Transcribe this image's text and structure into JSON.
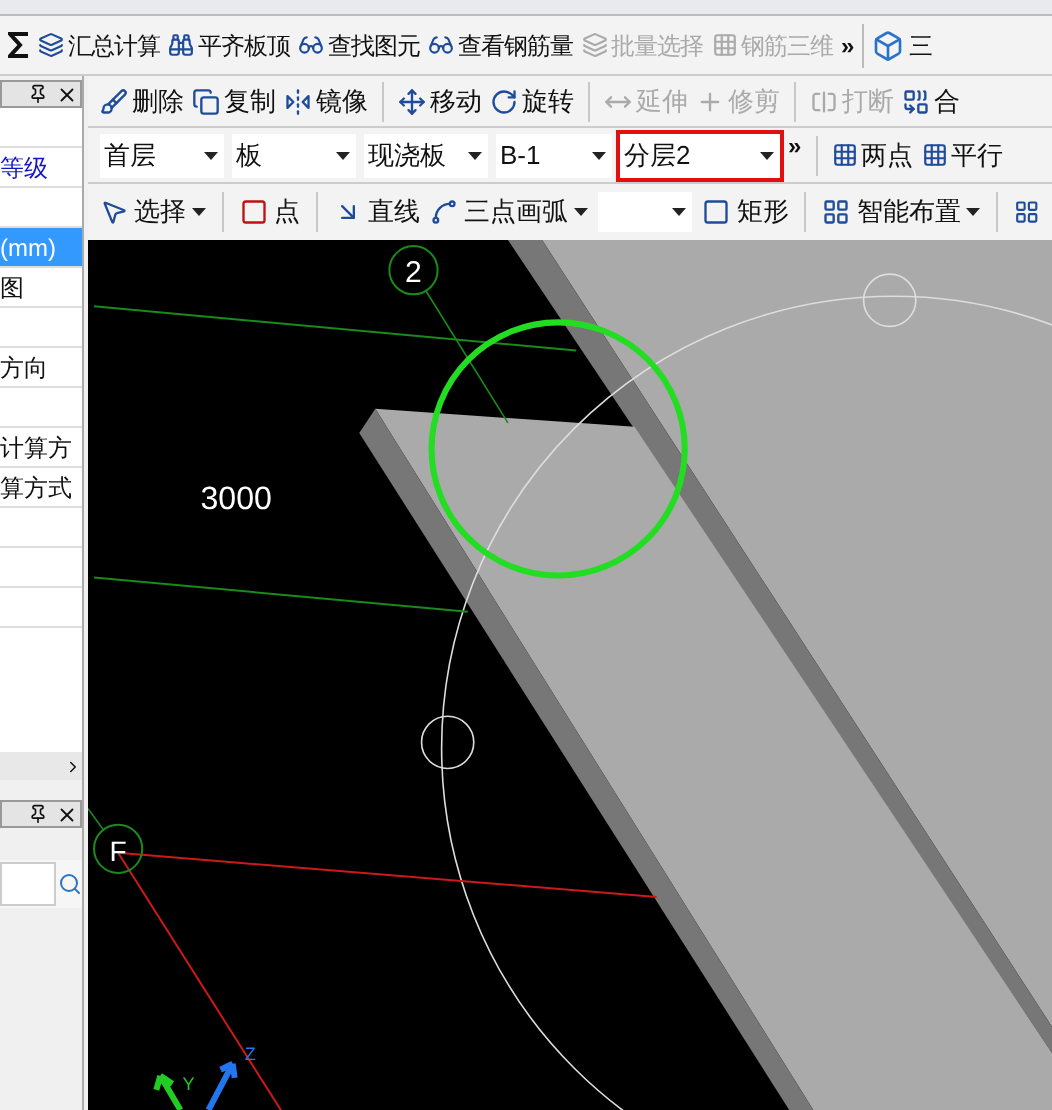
{
  "main_toolbar": {
    "items": [
      {
        "label": "汇总计算",
        "disabled": false
      },
      {
        "label": "平齐板顶",
        "disabled": false
      },
      {
        "label": "查找图元",
        "disabled": false
      },
      {
        "label": "查看钢筋量",
        "disabled": false
      },
      {
        "label": "批量选择",
        "disabled": true
      },
      {
        "label": "钢筋三维",
        "disabled": true
      }
    ],
    "overflow": "»",
    "view_tab": "三"
  },
  "edit_toolbar": {
    "items": [
      {
        "label": "删除",
        "disabled": false
      },
      {
        "label": "复制",
        "disabled": false
      },
      {
        "label": "镜像",
        "disabled": false
      },
      {
        "label": "移动",
        "disabled": false
      },
      {
        "label": "旋转",
        "disabled": false
      },
      {
        "label": "延伸",
        "disabled": true
      },
      {
        "label": "修剪",
        "disabled": true
      },
      {
        "label": "打断",
        "disabled": true
      },
      {
        "label": "合",
        "disabled": false
      }
    ]
  },
  "selector_toolbar": {
    "combos": [
      {
        "value": "首层",
        "highlighted": false
      },
      {
        "value": "板",
        "highlighted": false
      },
      {
        "value": "现浇板",
        "highlighted": false
      },
      {
        "value": "B-1",
        "highlighted": false
      },
      {
        "value": "分层2",
        "highlighted": true
      }
    ],
    "overflow": "»",
    "tools": [
      "两点",
      "平行"
    ]
  },
  "draw_toolbar": {
    "items": [
      {
        "kind": "dropdown",
        "label": "选择"
      },
      {
        "kind": "button",
        "label": "点"
      },
      {
        "kind": "button",
        "label": "直线"
      },
      {
        "kind": "dropdown",
        "label": "三点画弧"
      },
      {
        "kind": "combo"
      },
      {
        "kind": "button",
        "label": "矩形"
      },
      {
        "kind": "dropdown",
        "label": "智能布置"
      }
    ]
  },
  "property_panel": {
    "rows": [
      {
        "selected": false
      },
      {
        "label": "等级",
        "selected": false,
        "link": true
      },
      {
        "selected": false
      },
      {
        "label": "(mm)",
        "selected": true,
        "link": false
      },
      {
        "label": "图",
        "selected": false,
        "link": false
      },
      {
        "selected": false
      },
      {
        "label": "方向",
        "selected": false,
        "link": false
      },
      {
        "selected": false
      },
      {
        "label": "计算方",
        "selected": false,
        "link": false
      },
      {
        "label": "算方式",
        "selected": false,
        "link": false
      },
      {
        "selected": false
      },
      {
        "selected": false
      },
      {
        "selected": false
      }
    ]
  },
  "canvas": {
    "dimension": "3000",
    "axis_labels": [
      "2",
      "F"
    ],
    "gizmo_labels": [
      "Y",
      "Z"
    ]
  }
}
